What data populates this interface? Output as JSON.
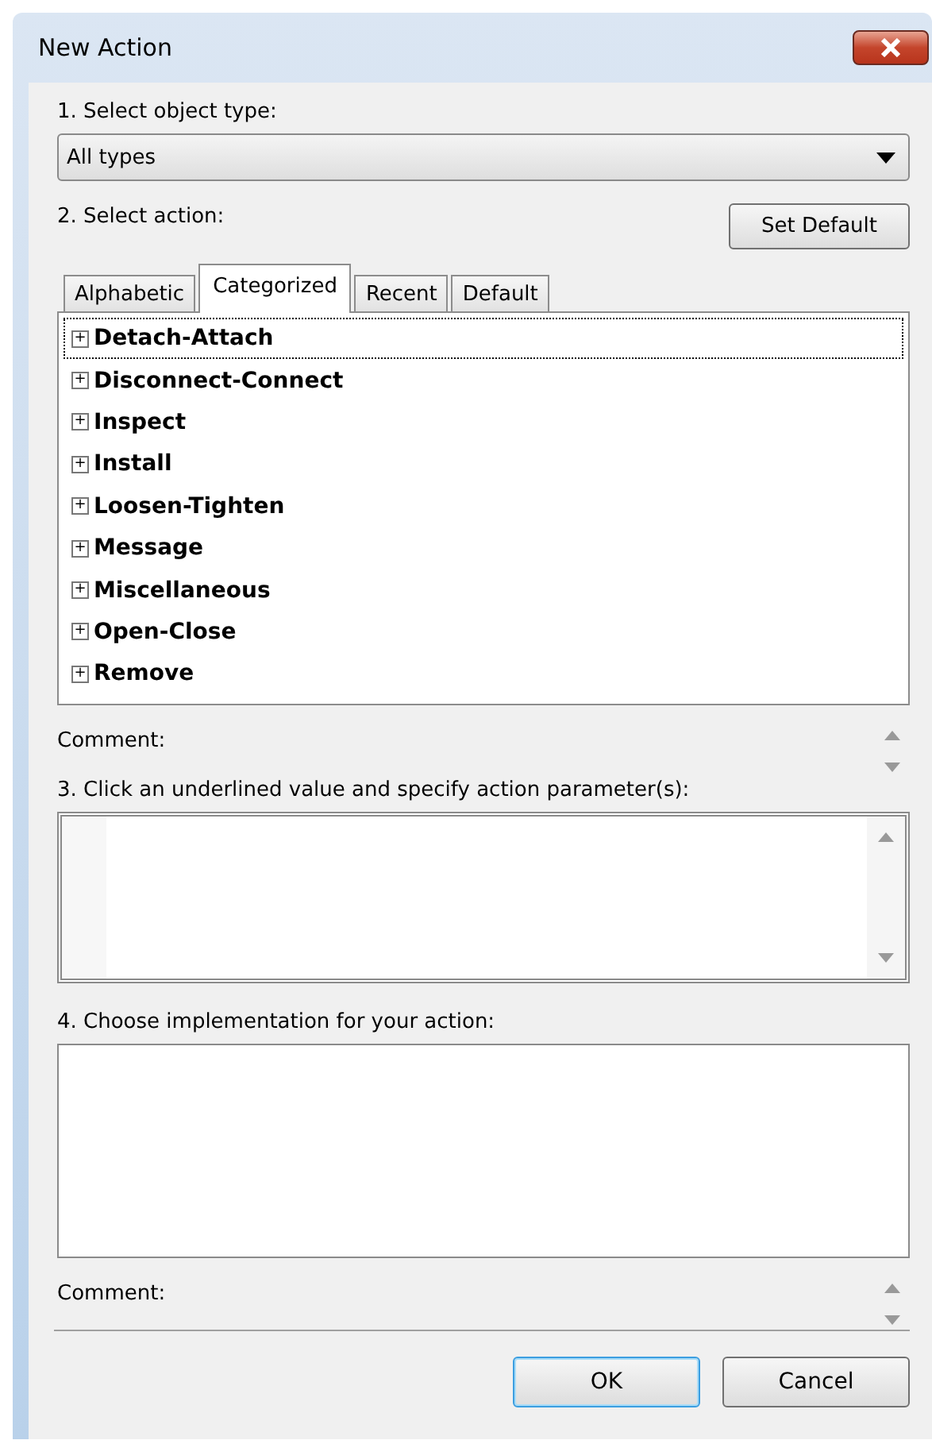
{
  "window": {
    "title": "New Action"
  },
  "object_type": {
    "label": "1. Select object type:",
    "value": "All types"
  },
  "action": {
    "label": "2. Select action:",
    "set_default": "Set Default",
    "tabs": [
      {
        "label": "Alphabetic",
        "selected": false
      },
      {
        "label": "Categorized",
        "selected": true
      },
      {
        "label": "Recent",
        "selected": false
      },
      {
        "label": "Default",
        "selected": false
      }
    ],
    "tree": [
      {
        "label": "Detach-Attach",
        "expander": "+",
        "focused": true
      },
      {
        "label": "Disconnect-Connect",
        "expander": "+",
        "focused": false
      },
      {
        "label": "Inspect",
        "expander": "+",
        "focused": false
      },
      {
        "label": "Install",
        "expander": "+",
        "focused": false
      },
      {
        "label": "Loosen-Tighten",
        "expander": "+",
        "focused": false
      },
      {
        "label": "Message",
        "expander": "+",
        "focused": false
      },
      {
        "label": "Miscellaneous",
        "expander": "+",
        "focused": false
      },
      {
        "label": "Open-Close",
        "expander": "+",
        "focused": false
      },
      {
        "label": "Remove",
        "expander": "+",
        "focused": false
      }
    ],
    "comment_label": "Comment:"
  },
  "parameters": {
    "label": "3. Click an underlined value and specify action parameter(s):"
  },
  "implementation": {
    "label": "4. Choose implementation for your action:",
    "comment_label": "Comment:"
  },
  "buttons": [
    {
      "label": "OK",
      "default": true
    },
    {
      "label": "Cancel",
      "default": false
    }
  ]
}
